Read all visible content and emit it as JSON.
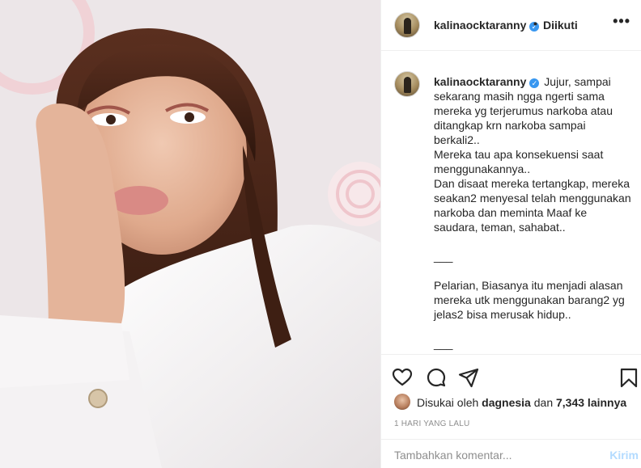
{
  "post": {
    "username": "kalinaocktaranny",
    "verified_icon": "verified-badge-icon",
    "separator": "•",
    "follow_label": "Diikuti",
    "more_label": "•••"
  },
  "caption": {
    "username": "kalinaocktaranny",
    "text": "Jujur, sampai sekarang masih ngga ngerti sama mereka yg terjerumus narkoba atau ditangkap krn narkoba sampai berkali2..\nMereka tau apa konsekuensi saat menggunakannya..\nDan disaat mereka tertangkap, mereka seakan2 menyesal telah menggunakan narkoba dan meminta Maaf ke saudara, teman, sahabat..\n\n___\n\nPelarian, Biasanya itu menjadi alasan mereka utk menggunakan barang2 yg jelas2 bisa merusak hidup..\n\n___"
  },
  "actions": {
    "like_icon": "heart-icon",
    "comment_icon": "comment-icon",
    "share_icon": "paper-plane-icon",
    "save_icon": "bookmark-icon"
  },
  "likes": {
    "prefix": "Disukai oleh",
    "user": "dagnesia",
    "conjunction": "dan",
    "count": "7,343 lainnya"
  },
  "timestamp": "1 HARI YANG LALU",
  "comment_box": {
    "placeholder": "Tambahkan komentar...",
    "post_label": "Kirim"
  },
  "colors": {
    "accent": "#3897f0",
    "post_disabled": "#b3dbff",
    "muted": "#8e8e8e",
    "text": "#262626"
  }
}
